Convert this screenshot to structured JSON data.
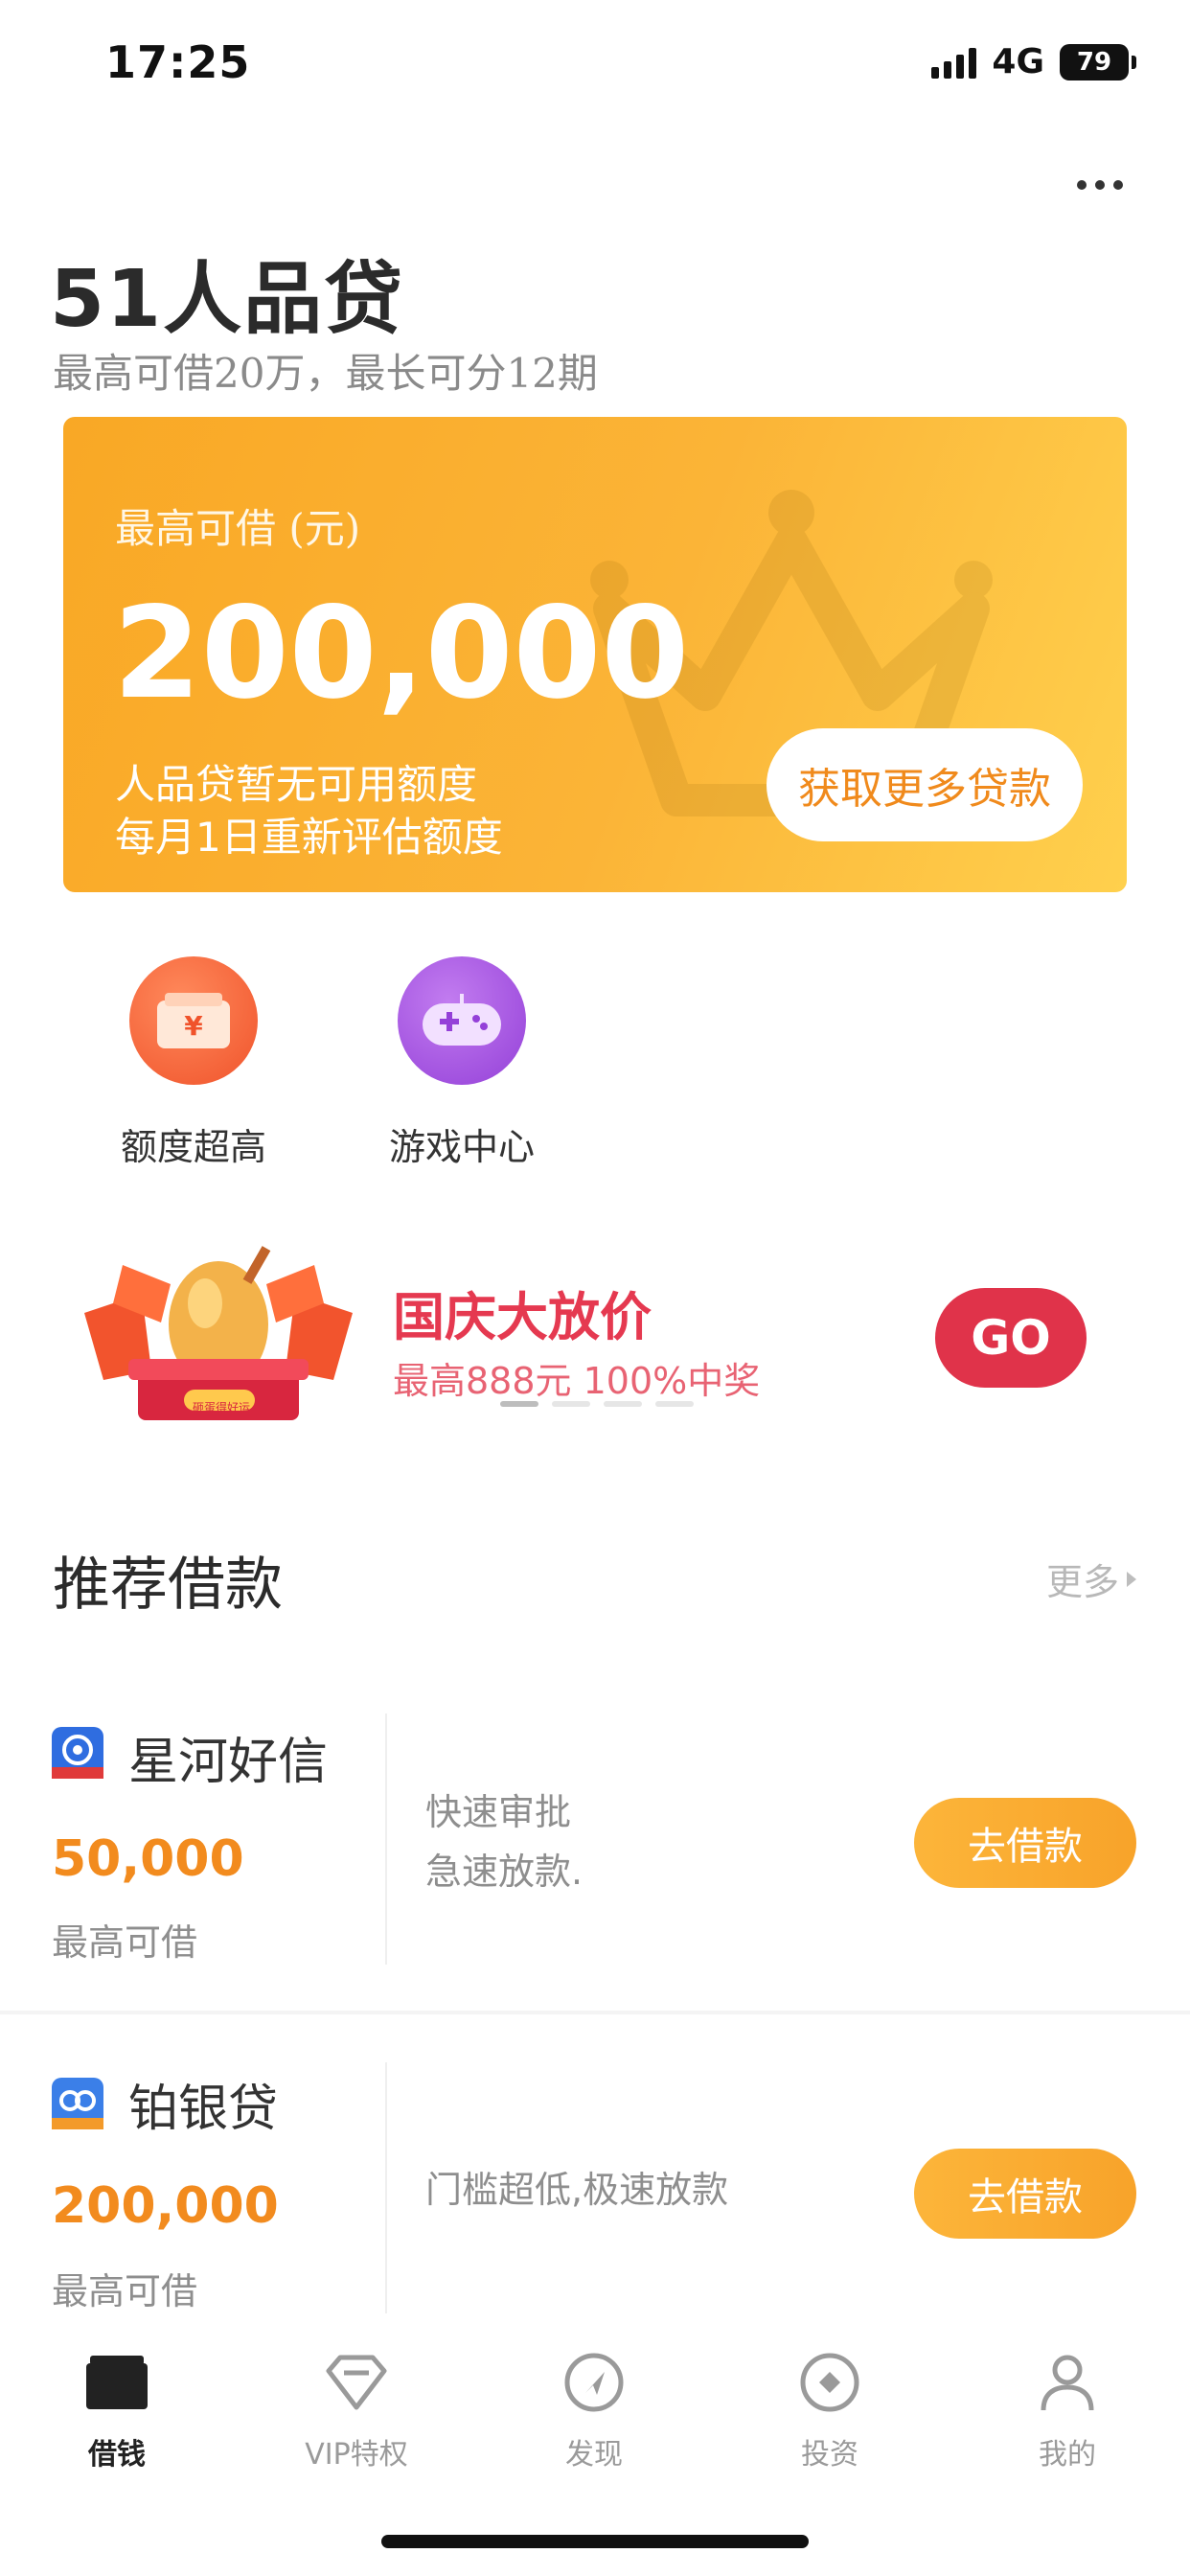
{
  "status_bar": {
    "time": "17:25",
    "network": "4G",
    "battery": "79"
  },
  "header": {
    "title": "51人品贷",
    "subtitle": "最高可借20万，最长可分12期"
  },
  "hero": {
    "label": "最高可借 (元)",
    "amount": "200,000",
    "line1": "人品贷暂无可用额度",
    "line2": "每月1日重新评估额度",
    "button": "获取更多贷款"
  },
  "quick_links": [
    {
      "label": "额度超高",
      "icon": "wallet-icon",
      "color": "#f5673a"
    },
    {
      "label": "游戏中心",
      "icon": "gamepad-icon",
      "color": "#a95ae0"
    }
  ],
  "banner": {
    "title": "国庆大放价",
    "subtitle": "最高888元 100%中奖",
    "button": "GO",
    "egg_caption": "砸蛋得好运"
  },
  "recommend": {
    "title": "推荐借款",
    "more": "更多",
    "items": [
      {
        "name": "星河好信",
        "amount": "50,000",
        "caption": "最高可借",
        "desc1": "快速审批",
        "desc2": "急速放款.",
        "button": "去借款"
      },
      {
        "name": "铂银贷",
        "amount": "200,000",
        "caption": "最高可借",
        "desc1": "门槛超低,极速放款",
        "desc2": "",
        "button": "去借款"
      }
    ]
  },
  "tabs": [
    {
      "label": "借钱",
      "icon": "wallet-tab-icon",
      "active": true
    },
    {
      "label": "VIP特权",
      "icon": "diamond-icon",
      "active": false
    },
    {
      "label": "发现",
      "icon": "compass-icon",
      "active": false
    },
    {
      "label": "投资",
      "icon": "invest-icon",
      "active": false
    },
    {
      "label": "我的",
      "icon": "profile-icon",
      "active": false
    }
  ],
  "colors": {
    "accent": "#f9a825",
    "brand_red": "#e0334a",
    "amount_orange": "#f28b1e"
  }
}
